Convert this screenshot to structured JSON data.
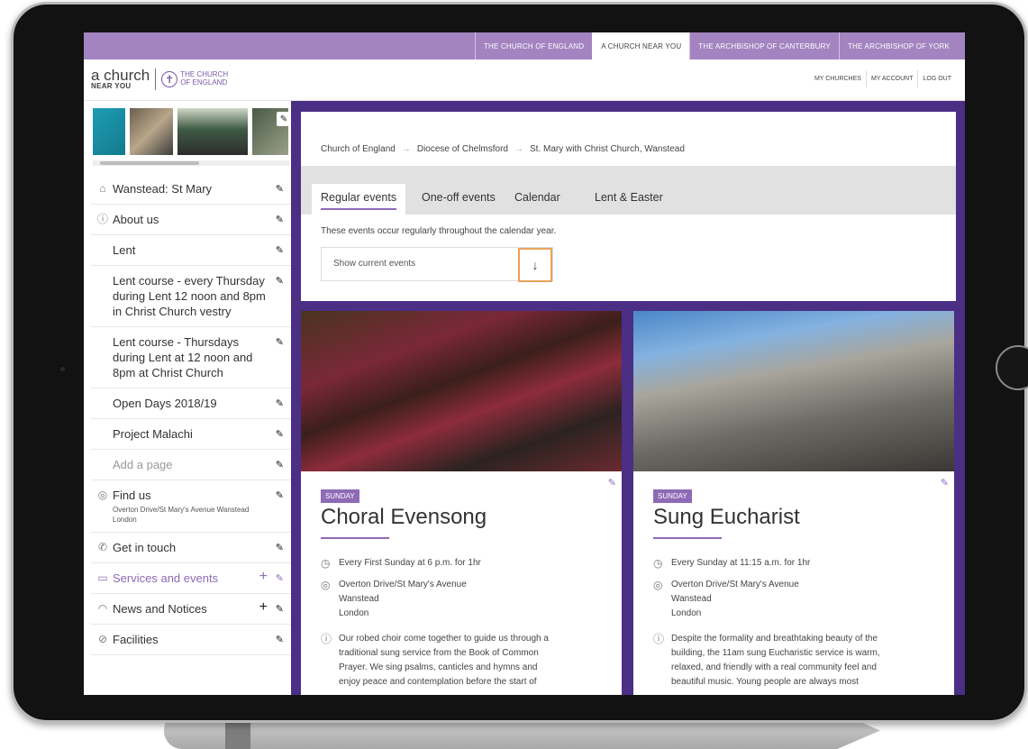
{
  "topnav": {
    "items": [
      {
        "label": "THE CHURCH OF ENGLAND"
      },
      {
        "label": "A CHURCH NEAR YOU"
      },
      {
        "label": "THE ARCHBISHOP OF CANTERBURY"
      },
      {
        "label": "THE ARCHBISHOP OF YORK"
      }
    ],
    "active_index": 1
  },
  "header": {
    "logo_line1": "a church",
    "logo_line2": "NEAR YOU",
    "logo_coe_line1": "THE CHURCH",
    "logo_coe_line2": "OF ENGLAND",
    "links": [
      {
        "label": "MY CHURCHES"
      },
      {
        "label": "MY ACCOUNT"
      },
      {
        "label": "LOG OUT"
      }
    ]
  },
  "sidebar": {
    "items": [
      {
        "label": "Wanstead: St Mary",
        "icon": "home-icon"
      },
      {
        "label": "About us",
        "icon": "info-icon"
      },
      {
        "label": "Lent"
      },
      {
        "label": "Lent course - every Thursday during Lent 12 noon and 8pm in Christ Church vestry"
      },
      {
        "label": "Lent course - Thursdays during Lent at 12 noon and 8pm at Christ Church"
      },
      {
        "label": "Open Days 2018/19"
      },
      {
        "label": "Project Malachi"
      },
      {
        "label": "Add a page"
      },
      {
        "label": "Find us",
        "sub": "Overton Drive/St Mary's Avenue Wanstead London",
        "icon": "compass-icon"
      },
      {
        "label": "Get in touch",
        "icon": "phone-icon"
      },
      {
        "label": "Services and events",
        "icon": "calendar-icon"
      },
      {
        "label": "News and Notices",
        "icon": "broadcast-icon"
      },
      {
        "label": "Facilities",
        "icon": "check-circle-icon"
      }
    ]
  },
  "breadcrumb": {
    "items": [
      "Church of England",
      "Diocese of Chelmsford",
      "St. Mary with Christ Church, Wanstead"
    ],
    "separator": "→"
  },
  "tabs": {
    "items": [
      "Regular events",
      "One-off events",
      "Calendar",
      "Lent & Easter"
    ],
    "active_index": 0,
    "description": "These events occur regularly throughout the calendar year."
  },
  "filter": {
    "label": "Show current events",
    "arrow": "↓"
  },
  "events": [
    {
      "day": "SUNDAY",
      "title": "Choral Evensong",
      "time": "Every First Sunday at 6 p.m. for 1hr",
      "address": [
        "Overton Drive/St Mary's Avenue",
        "Wanstead",
        "London"
      ],
      "description": [
        "Our robed choir come together to guide us through a",
        "traditional sung service from the Book of Common",
        "Prayer. We sing psalms, canticles and hymns and",
        "enjoy peace and contemplation before the start of"
      ]
    },
    {
      "day": "SUNDAY",
      "title": "Sung Eucharist",
      "time": "Every Sunday at 11:15 a.m. for 1hr",
      "address": [
        "Overton Drive/St Mary's Avenue",
        "Wanstead",
        "London"
      ],
      "description": [
        "Despite the formality and breathtaking beauty of the",
        "building, the 11am sung Eucharistic service is warm,",
        "relaxed, and friendly with a real community feel and",
        "beautiful music. Young people are always most"
      ]
    }
  ],
  "colors": {
    "accent": "#8e6ab7",
    "topbar": "#a384c0",
    "frame": "#4a2f85",
    "filter_highlight": "#e8a35a"
  }
}
